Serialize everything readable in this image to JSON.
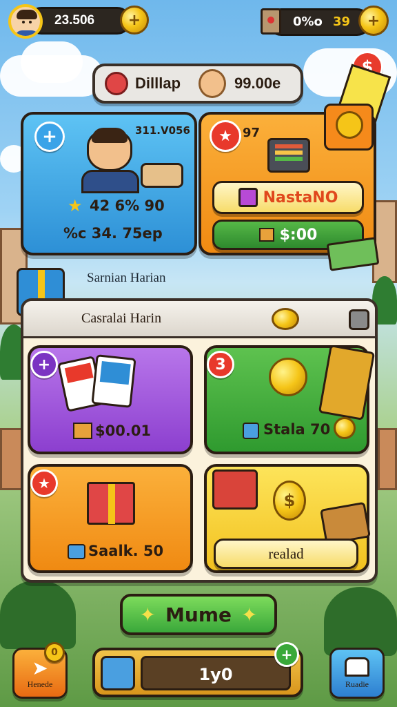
{
  "top_bar": {
    "coins": "23.506",
    "right_value": "0%o",
    "right_value_2": "39"
  },
  "header_pill": {
    "left_label": "Dilllap",
    "right_label": "99.00e"
  },
  "card_profile": {
    "title": "311.V056",
    "stat_line": "42 6% 90",
    "money_line": "%c 34. 75ep"
  },
  "card_offer": {
    "number": "97",
    "button_label": "NastaNO",
    "price": "$:00"
  },
  "section_heading": "Sarnian Harian",
  "panel_heading": "Casralai Harin",
  "tiles": [
    {
      "badge": "+",
      "value": "$00.01",
      "color": "#9b4fd6"
    },
    {
      "badge": "3",
      "value": "Stala 70",
      "color": "#3ca83a"
    },
    {
      "badge": "★",
      "value": "Saalk. 50",
      "color": "#f39a1b"
    },
    {
      "badge": "",
      "value": "realad",
      "color": "#f5cf2a"
    }
  ],
  "main_button": "Mume",
  "bottom_bar": {
    "left_label": "Henede",
    "center_value": "1y0",
    "right_label": "Ruadie",
    "left_badge": "0",
    "center_badge": "+"
  }
}
